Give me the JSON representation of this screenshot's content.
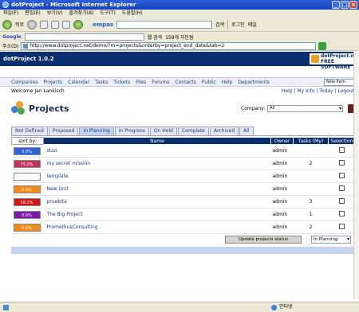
{
  "window": {
    "title": "dotProject - Microsoft Internet Explorer"
  },
  "menubar": [
    "파일(F)",
    "편집(E)",
    "보기(V)",
    "즐겨찾기(A)",
    "도구(T)",
    "도움말(H)"
  ],
  "toolbar": {
    "back": "뒤로",
    "search_brand": "empas",
    "search_button": "검색",
    "login": "로그인",
    "mail": "메일"
  },
  "google": {
    "label": "Google",
    "search": "웹 검색",
    "blocked": "158개 차단됨"
  },
  "address": {
    "label": "주소(D)",
    "url": "http://www.dotproject.net/demo/?m=projects&orderby=project_end_date&tab=2"
  },
  "app": {
    "title": "dotProject 1.0.2",
    "logo_line1": "dotProject.net",
    "logo_line2": "FREE SOFTWARE"
  },
  "nav": {
    "items": [
      "Companies",
      "Projects",
      "Calendar",
      "Tasks",
      "Tickets",
      "Files",
      "Forums",
      "Contacts",
      "Public",
      "Help",
      "Departments"
    ],
    "new_item": "New Item"
  },
  "welcome": "Welcome Jan Lankisch",
  "toplinks": "Help | My Info | Today | Logout",
  "page": {
    "title": "Projects",
    "company_label": "Company:",
    "company_value": "All"
  },
  "tabs": [
    {
      "label": "Not Defined",
      "active": false
    },
    {
      "label": "Proposed",
      "active": false
    },
    {
      "label": "In Planning",
      "active": true
    },
    {
      "label": "In Progress",
      "active": false
    },
    {
      "label": "On Hold",
      "active": false
    },
    {
      "label": "Complete",
      "active": false
    },
    {
      "label": "Archived",
      "active": false
    },
    {
      "label": "All",
      "active": false
    }
  ],
  "table": {
    "sort_label": "sort by:",
    "headers": {
      "name": "Name",
      "owner": "Owner",
      "tasks": "Tasks (My)",
      "selection": "Selection"
    },
    "rows": [
      {
        "pct": "0.0%",
        "color": "#2f63d6",
        "name": "dust",
        "owner": "admin",
        "tasks": ""
      },
      {
        "pct": "75.0%",
        "color": "#c2335a",
        "name": "my secret mission",
        "owner": "admin",
        "tasks": "2"
      },
      {
        "pct": "",
        "color": "#ffffff",
        "name": "template",
        "owner": "admin",
        "tasks": ""
      },
      {
        "pct": "0.0%",
        "color": "#f08a18",
        "name": "New Unit",
        "owner": "admin",
        "tasks": ""
      },
      {
        "pct": "18.3%",
        "color": "#d11818",
        "name": "pruebita",
        "owner": "admin",
        "tasks": "3"
      },
      {
        "pct": "0.0%",
        "color": "#7b1aa8",
        "name": "The Big Project",
        "owner": "admin",
        "tasks": "1"
      },
      {
        "pct": "0.0%",
        "color": "#f08a18",
        "name": "PromethusConsulting",
        "owner": "admin",
        "tasks": "2"
      }
    ]
  },
  "update_button": "Update projects status",
  "status_select": "In Planning",
  "statusbar": {
    "zone": "인터넷"
  }
}
